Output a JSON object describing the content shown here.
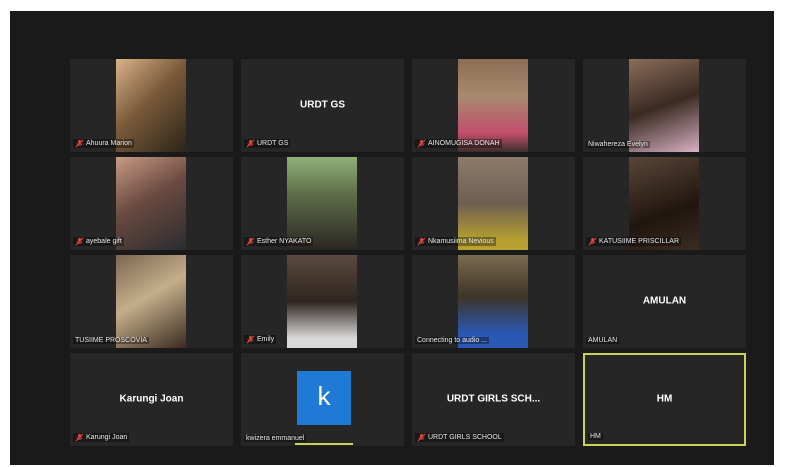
{
  "participants": [
    {
      "name": "Ahuura  Marion",
      "muted": true,
      "video": "room-warm"
    },
    {
      "name": "URDT GS",
      "display": "URDT GS",
      "muted": true
    },
    {
      "name": "AINOMUGISA DONAH",
      "muted": true,
      "video": "outdoor-wall"
    },
    {
      "name": "Niwahereza Evelyn",
      "muted": false,
      "video": "indoor-dark-earphones"
    },
    {
      "name": "ayebale gift",
      "muted": true,
      "video": "room-curtain"
    },
    {
      "name": "Esther NYAKATO",
      "muted": true,
      "video": "outdoor-trees"
    },
    {
      "name": "Nkamusiima Nevious",
      "muted": true,
      "video": "brick-wall-yellow"
    },
    {
      "name": "KATUSIIME PRISCILLAR",
      "muted": true,
      "video": "dark-room"
    },
    {
      "name": "TUSIIME PROSCOVIA",
      "muted": false,
      "video": "brick-wall-close"
    },
    {
      "name": "Emily",
      "muted": true,
      "video": "indoor-white-shirt"
    },
    {
      "name": "Connecting to audio ...",
      "muted": false,
      "video": "blue-shirt"
    },
    {
      "name": "AMULAN",
      "display": "AMULAN",
      "muted": false
    },
    {
      "name": "Karungi Joan",
      "display": "Karungi Joan",
      "muted": true
    },
    {
      "name": "kwizera emmanuel",
      "muted": false,
      "avatar_letter": "k",
      "speaking": true
    },
    {
      "name": "URDT GIRLS SCHOOL",
      "display": "URDT GIRLS SCH...",
      "muted": true
    },
    {
      "name": "HM",
      "display": "HM",
      "muted": false,
      "active": true
    }
  ],
  "colors": {
    "window_bg": "#1a1a1a",
    "tile_bg": "#262626",
    "active_border": "#c9d15a",
    "mute_icon": "#e0463a",
    "avatar_bg": "#1f7ad6"
  }
}
